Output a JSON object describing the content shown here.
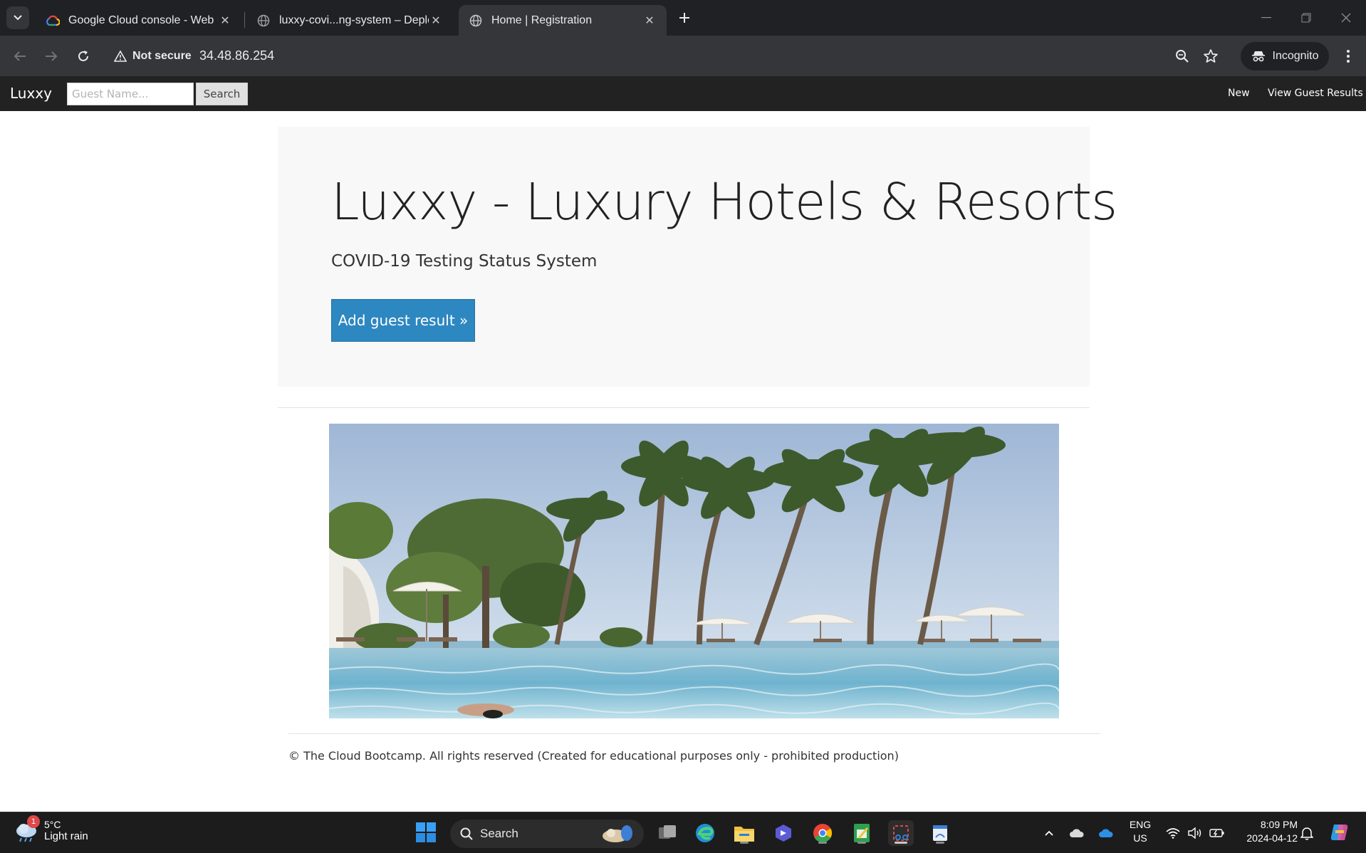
{
  "browser": {
    "tabs": [
      {
        "title": "Google Cloud console - Web UI",
        "favicon": "google-cloud-icon",
        "active": false
      },
      {
        "title": "luxxy-covi...ng-system – Deploy",
        "favicon": "globe-icon",
        "active": false
      },
      {
        "title": "Home | Registration",
        "favicon": "globe-icon",
        "active": true
      }
    ],
    "security_label": "Not secure",
    "url": "34.48.86.254",
    "incognito_label": "Incognito"
  },
  "site": {
    "brand": "Luxxy",
    "search": {
      "placeholder": "Guest Name...",
      "button_label": "Search"
    },
    "nav_links": [
      "New",
      "View Guest Results"
    ],
    "hero_title": "Luxxy - Luxury Hotels & Resorts",
    "hero_subtitle": "COVID-19 Testing Status System",
    "cta_label": "Add guest result »",
    "footer": "© The Cloud Bootcamp. All rights reserved (Created for educational purposes only - prohibited production)"
  },
  "taskbar": {
    "weather": {
      "temp": "5°C",
      "condition": "Light rain",
      "badge": "1"
    },
    "search_label": "Search",
    "lang": {
      "line1": "ENG",
      "line2": "US"
    },
    "clock": {
      "time": "8:09 PM",
      "date": "2024-04-12"
    },
    "pinned_apps": [
      "task-view-icon",
      "edge-icon",
      "file-explorer-icon",
      "copilot-icon",
      "chrome-icon",
      "sheets-icon",
      "snipping-tool-icon",
      "paint-icon"
    ]
  },
  "colors": {
    "chrome_dark": "#202124",
    "chrome_toolbar": "#35363a",
    "site_nav": "#222222",
    "jumbotron": "#f8f8f8",
    "cta": "#2d87c0",
    "taskbar": "#1c1c1c"
  }
}
